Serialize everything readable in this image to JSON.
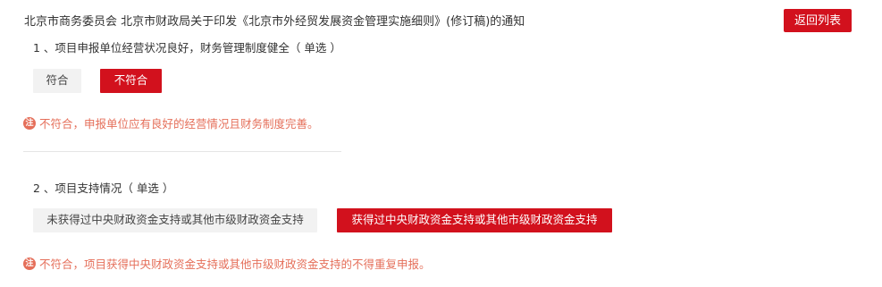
{
  "header": {
    "title": "北京市商务委员会 北京市财政局关于印发《北京市外经贸发展资金管理实施细则》(修订稿)的通知",
    "back_button": "返回列表"
  },
  "questions": [
    {
      "label": "1 、项目申报单位经营状况良好，财务管理制度健全（ 单选 ）",
      "options": [
        "符合",
        "不符合"
      ],
      "selected": "不符合",
      "note_icon": "注",
      "note": "不符合，申报单位应有良好的经营情况且财务制度完善。"
    },
    {
      "label": "2 、项目支持情况（ 单选 ）",
      "options": [
        "未获得过中央财政资金支持或其他市级财政资金支持",
        "获得过中央财政资金支持或其他市级财政资金支持"
      ],
      "selected": "获得过中央财政资金支持或其他市级财政资金支持",
      "note_icon": "注",
      "note": "不符合，项目获得中央财政资金支持或其他市级财政资金支持的不得重复申报。"
    }
  ],
  "colors": {
    "accent": "#d2111d",
    "warning_text": "#e56f5a",
    "option_bg": "#f2f2f2"
  }
}
